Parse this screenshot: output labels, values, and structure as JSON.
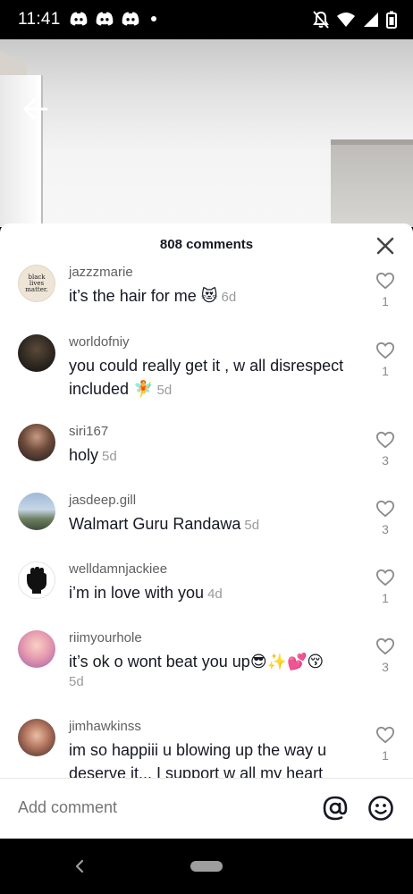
{
  "status_bar": {
    "time": "11:41",
    "notification_icons": [
      "discord-icon",
      "discord-icon",
      "discord-icon",
      "dot-icon"
    ],
    "right_icons": [
      "mute-icon",
      "wifi-icon",
      "signal-icon",
      "battery-icon"
    ]
  },
  "header": {
    "comments_count": "808 comments"
  },
  "comments": [
    {
      "username": "jazzzmarie",
      "text": "it’s the hair for me",
      "emoji": "😻",
      "age": "6d",
      "likes": "1"
    },
    {
      "username": "worldofniy",
      "text": "you could really get it , w all disrespect included",
      "emoji": "🧚",
      "age": "5d",
      "likes": "1"
    },
    {
      "username": "siri167",
      "text": "holy",
      "emoji": "",
      "age": "5d",
      "likes": "3"
    },
    {
      "username": "jasdeep.gill",
      "text": "Walmart Guru Randawa",
      "emoji": "",
      "age": "5d",
      "likes": "3"
    },
    {
      "username": "welldamnjackiee",
      "text": "i’m in love with you",
      "emoji": "",
      "age": "4d",
      "likes": "1"
    },
    {
      "username": "riimyourhole",
      "text": "it’s ok o wont beat you up",
      "emoji": "😎✨💕😚",
      "age": "5d",
      "likes": "3"
    },
    {
      "username": "jimhawkinss",
      "text": "im so happiii u blowing up the way u deserve it... I support w all my heart",
      "emoji": "",
      "age": "",
      "likes": "1"
    }
  ],
  "avatar_labels": {
    "jazzzmarie": "black lives matter."
  },
  "compose": {
    "placeholder": "Add comment"
  },
  "colors": {
    "primary_text": "#161823",
    "secondary_text": "#9a9a9a",
    "background": "#ffffff"
  }
}
